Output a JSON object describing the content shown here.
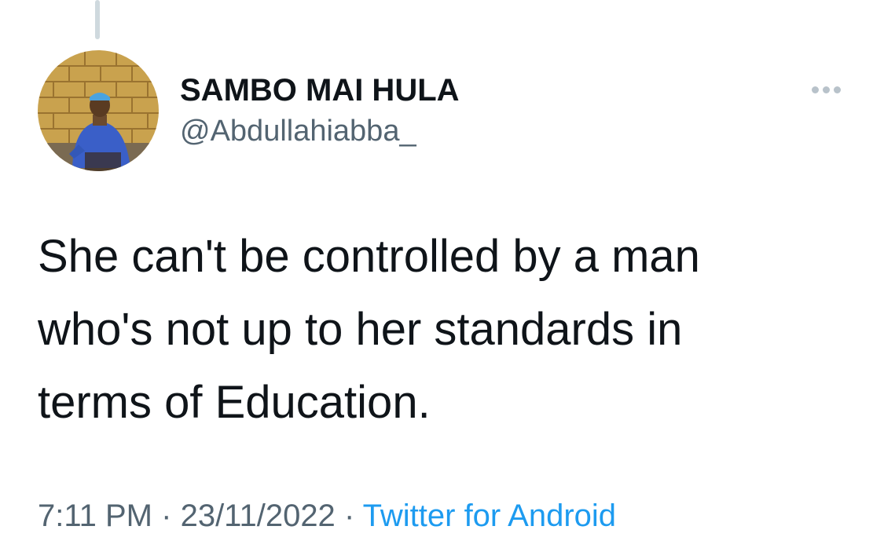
{
  "author": {
    "display_name": "SAMBO MAI HULA",
    "handle": "@Abdullahiabba_"
  },
  "tweet": {
    "text_lines": [
      "She can't be controlled by a man",
      "who's not up to her standards in",
      "terms of Education."
    ]
  },
  "meta": {
    "time": "7:11 PM",
    "separator": "·",
    "date": "23/11/2022",
    "source": "Twitter for Android"
  },
  "icons": {
    "more": "more-horizontal-icon"
  },
  "colors": {
    "text_primary": "#0f1419",
    "text_secondary": "#536471",
    "link": "#1d9bf0",
    "thread_line": "#cfd9de"
  }
}
